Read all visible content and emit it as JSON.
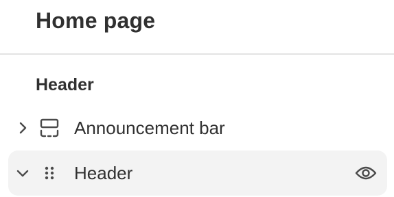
{
  "page": {
    "title": "Home page"
  },
  "sections": {
    "group_heading": "Header",
    "items": [
      {
        "label": "Announcement bar",
        "expanded": false,
        "icon": "section-block-icon",
        "chevron": "chevron-right-icon"
      },
      {
        "label": "Header",
        "expanded": true,
        "icon": "drag-handle-icon",
        "chevron": "chevron-down-icon",
        "visibility_icon": "eye-icon",
        "highlighted": true
      }
    ]
  },
  "colors": {
    "text": "#303030",
    "divider": "#e3e3e3",
    "row_highlight": "#f3f3f3",
    "icon": "#4a4a4a"
  }
}
